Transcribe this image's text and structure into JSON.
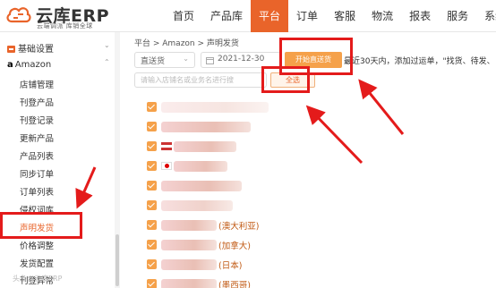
{
  "logo": {
    "title": "云库ERP",
    "subtitle": "云端调派 库销全球"
  },
  "nav": [
    "首页",
    "产品库",
    "平台",
    "订单",
    "客服",
    "物流",
    "报表",
    "服务",
    "系统"
  ],
  "nav_active_index": 2,
  "sidebar": {
    "groups": [
      {
        "label": "基础设置",
        "icon": "gear-icon"
      },
      {
        "label": "Amazon",
        "icon": "amazon-icon"
      }
    ],
    "items": [
      "店铺管理",
      "刊登产品",
      "刊登记录",
      "更新产品",
      "产品列表",
      "同步订单",
      "订单列表",
      "侵权词库",
      "声明发货",
      "价格调整",
      "发货配置",
      "刊登异常"
    ],
    "active_item_index": 8
  },
  "breadcrumb": "平台 > Amazon > 声明发货",
  "filters": {
    "type_value": "直送货",
    "date_value": "2021-12-30",
    "start_button": "开始直送货",
    "hint": "最近30天内，添加过运单，\"找货、待发、",
    "search_placeholder": "请输入店铺名或业务名进行搜",
    "all_button": "全选"
  },
  "stores": [
    {
      "label": ""
    },
    {
      "label": ""
    },
    {
      "label": ""
    },
    {
      "label": ""
    },
    {
      "label": ""
    },
    {
      "label": ""
    },
    {
      "label": "(澳大利亚)"
    },
    {
      "label": "(加拿大)"
    },
    {
      "label": "(日本)"
    },
    {
      "label": "(墨西哥)"
    }
  ],
  "watermark": "头条@云库ERP",
  "colors": {
    "accent": "#e9642a",
    "highlight": "#e41b1b"
  }
}
